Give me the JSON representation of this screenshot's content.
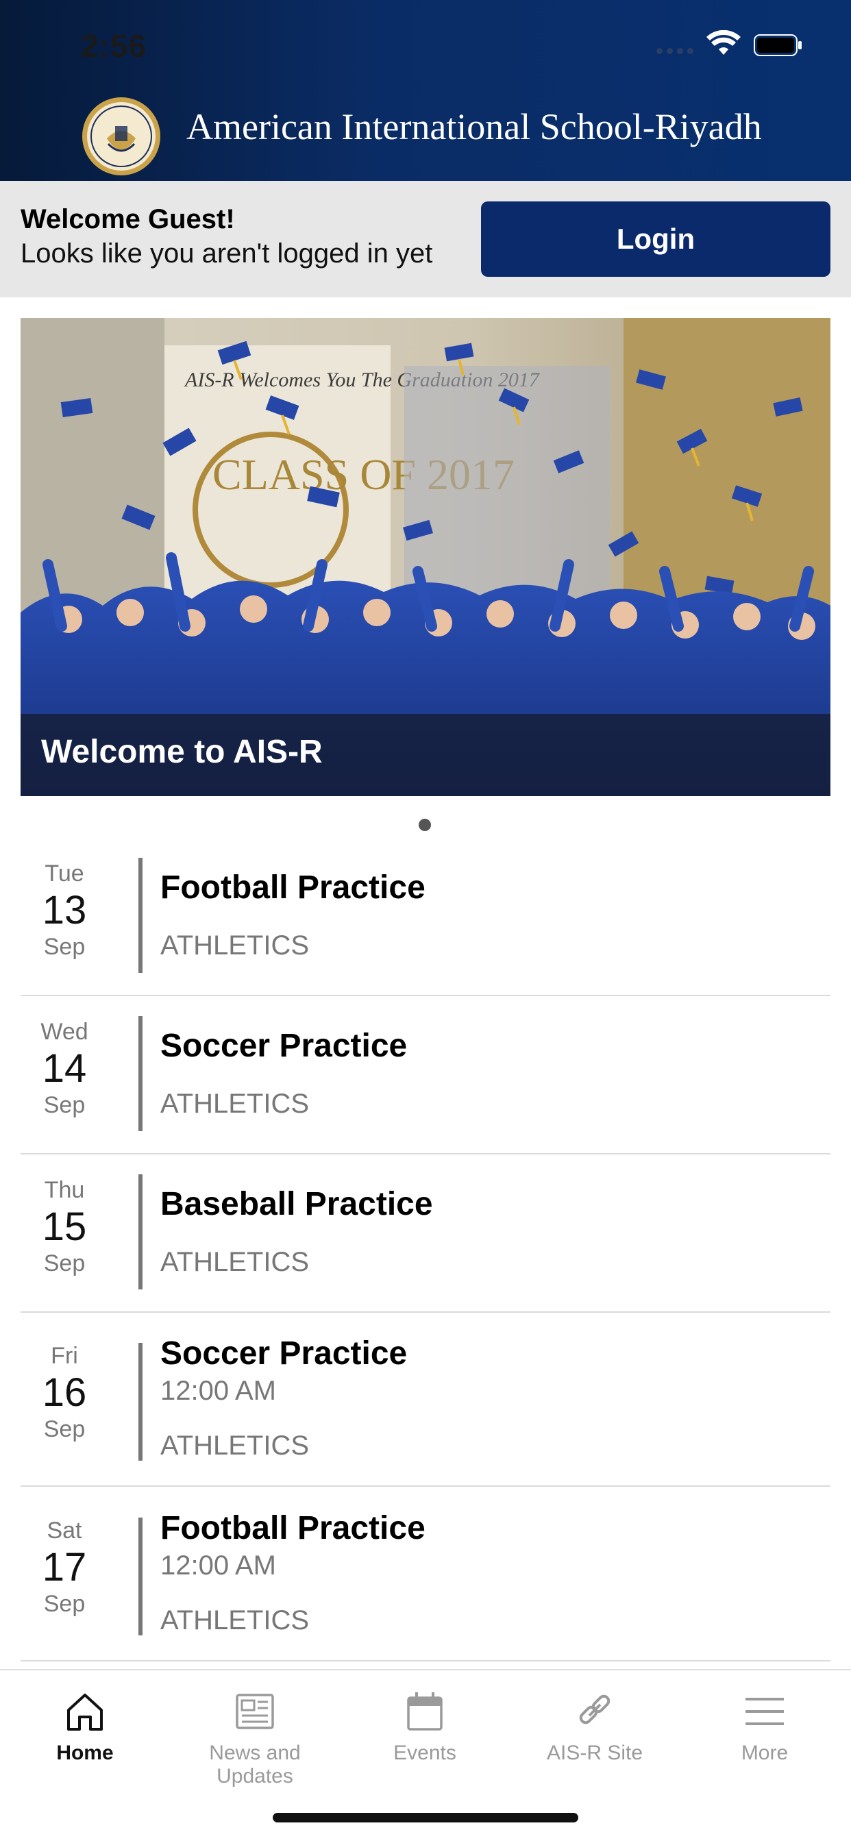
{
  "status_bar": {
    "time": "2:56"
  },
  "header": {
    "school_name": "American International School-Riyadh",
    "logo_icon": "school-crest-icon"
  },
  "welcome": {
    "title": "Welcome Guest!",
    "subtitle": "Looks like you aren't logged in yet",
    "login_label": "Login"
  },
  "hero": {
    "caption": "Welcome to AIS-R",
    "banner_text": "AIS-R Welcomes You The Graduation 2017",
    "class_text": "CLASS OF 2017"
  },
  "events": [
    {
      "dow": "Tue",
      "day": "13",
      "month": "Sep",
      "title": "Football Practice",
      "time": "",
      "category": "ATHLETICS"
    },
    {
      "dow": "Wed",
      "day": "14",
      "month": "Sep",
      "title": "Soccer Practice",
      "time": "",
      "category": "ATHLETICS"
    },
    {
      "dow": "Thu",
      "day": "15",
      "month": "Sep",
      "title": "Baseball Practice",
      "time": "",
      "category": "ATHLETICS"
    },
    {
      "dow": "Fri",
      "day": "16",
      "month": "Sep",
      "title": "Soccer Practice",
      "time": "12:00 AM",
      "category": "ATHLETICS"
    },
    {
      "dow": "Sat",
      "day": "17",
      "month": "Sep",
      "title": "Football Practice",
      "time": "12:00 AM",
      "category": "ATHLETICS"
    }
  ],
  "tabs": [
    {
      "label": "Home",
      "icon": "home-icon",
      "active": true
    },
    {
      "label": "News and Updates",
      "icon": "newspaper-icon",
      "active": false
    },
    {
      "label": "Events",
      "icon": "calendar-icon",
      "active": false
    },
    {
      "label": "AIS-R Site",
      "icon": "link-icon",
      "active": false
    },
    {
      "label": "More",
      "icon": "menu-icon",
      "active": false
    }
  ],
  "colors": {
    "header_dark": "#061a3a",
    "header_blue": "#0a2c66",
    "login_button": "#0a2a6c",
    "welcome_bar": "#e7e7e8"
  }
}
